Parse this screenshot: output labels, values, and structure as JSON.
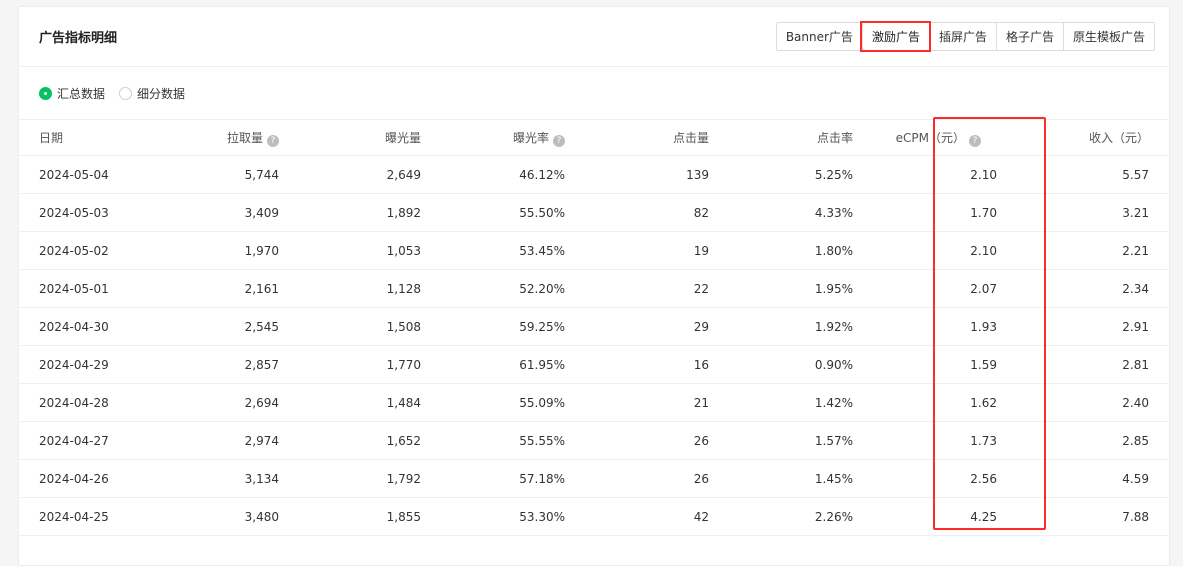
{
  "title": "广告指标明细",
  "tabs": [
    "Banner广告",
    "激励广告",
    "插屏广告",
    "格子广告",
    "原生模板广告"
  ],
  "active_tab": 1,
  "radios": [
    {
      "label": "汇总数据",
      "checked": true
    },
    {
      "label": "细分数据",
      "checked": false
    }
  ],
  "columns": [
    {
      "label": "日期",
      "help": false
    },
    {
      "label": "拉取量",
      "help": true
    },
    {
      "label": "曝光量",
      "help": false
    },
    {
      "label": "曝光率",
      "help": true
    },
    {
      "label": "点击量",
      "help": false
    },
    {
      "label": "点击率",
      "help": false
    },
    {
      "label": "eCPM（元）",
      "help": true
    },
    {
      "label": "收入（元）",
      "help": false
    }
  ],
  "rows": [
    [
      "2024-05-04",
      "5,744",
      "2,649",
      "46.12%",
      "139",
      "5.25%",
      "2.10",
      "5.57"
    ],
    [
      "2024-05-03",
      "3,409",
      "1,892",
      "55.50%",
      "82",
      "4.33%",
      "1.70",
      "3.21"
    ],
    [
      "2024-05-02",
      "1,970",
      "1,053",
      "53.45%",
      "19",
      "1.80%",
      "2.10",
      "2.21"
    ],
    [
      "2024-05-01",
      "2,161",
      "1,128",
      "52.20%",
      "22",
      "1.95%",
      "2.07",
      "2.34"
    ],
    [
      "2024-04-30",
      "2,545",
      "1,508",
      "59.25%",
      "29",
      "1.92%",
      "1.93",
      "2.91"
    ],
    [
      "2024-04-29",
      "2,857",
      "1,770",
      "61.95%",
      "16",
      "0.90%",
      "1.59",
      "2.81"
    ],
    [
      "2024-04-28",
      "2,694",
      "1,484",
      "55.09%",
      "21",
      "1.42%",
      "1.62",
      "2.40"
    ],
    [
      "2024-04-27",
      "2,974",
      "1,652",
      "55.55%",
      "26",
      "1.57%",
      "1.73",
      "2.85"
    ],
    [
      "2024-04-26",
      "3,134",
      "1,792",
      "57.18%",
      "26",
      "1.45%",
      "2.56",
      "4.59"
    ],
    [
      "2024-04-25",
      "3,480",
      "1,855",
      "53.30%",
      "42",
      "2.26%",
      "4.25",
      "7.88"
    ]
  ],
  "colors": {
    "accent": "#07c160",
    "highlight": "#ff2a2a"
  }
}
